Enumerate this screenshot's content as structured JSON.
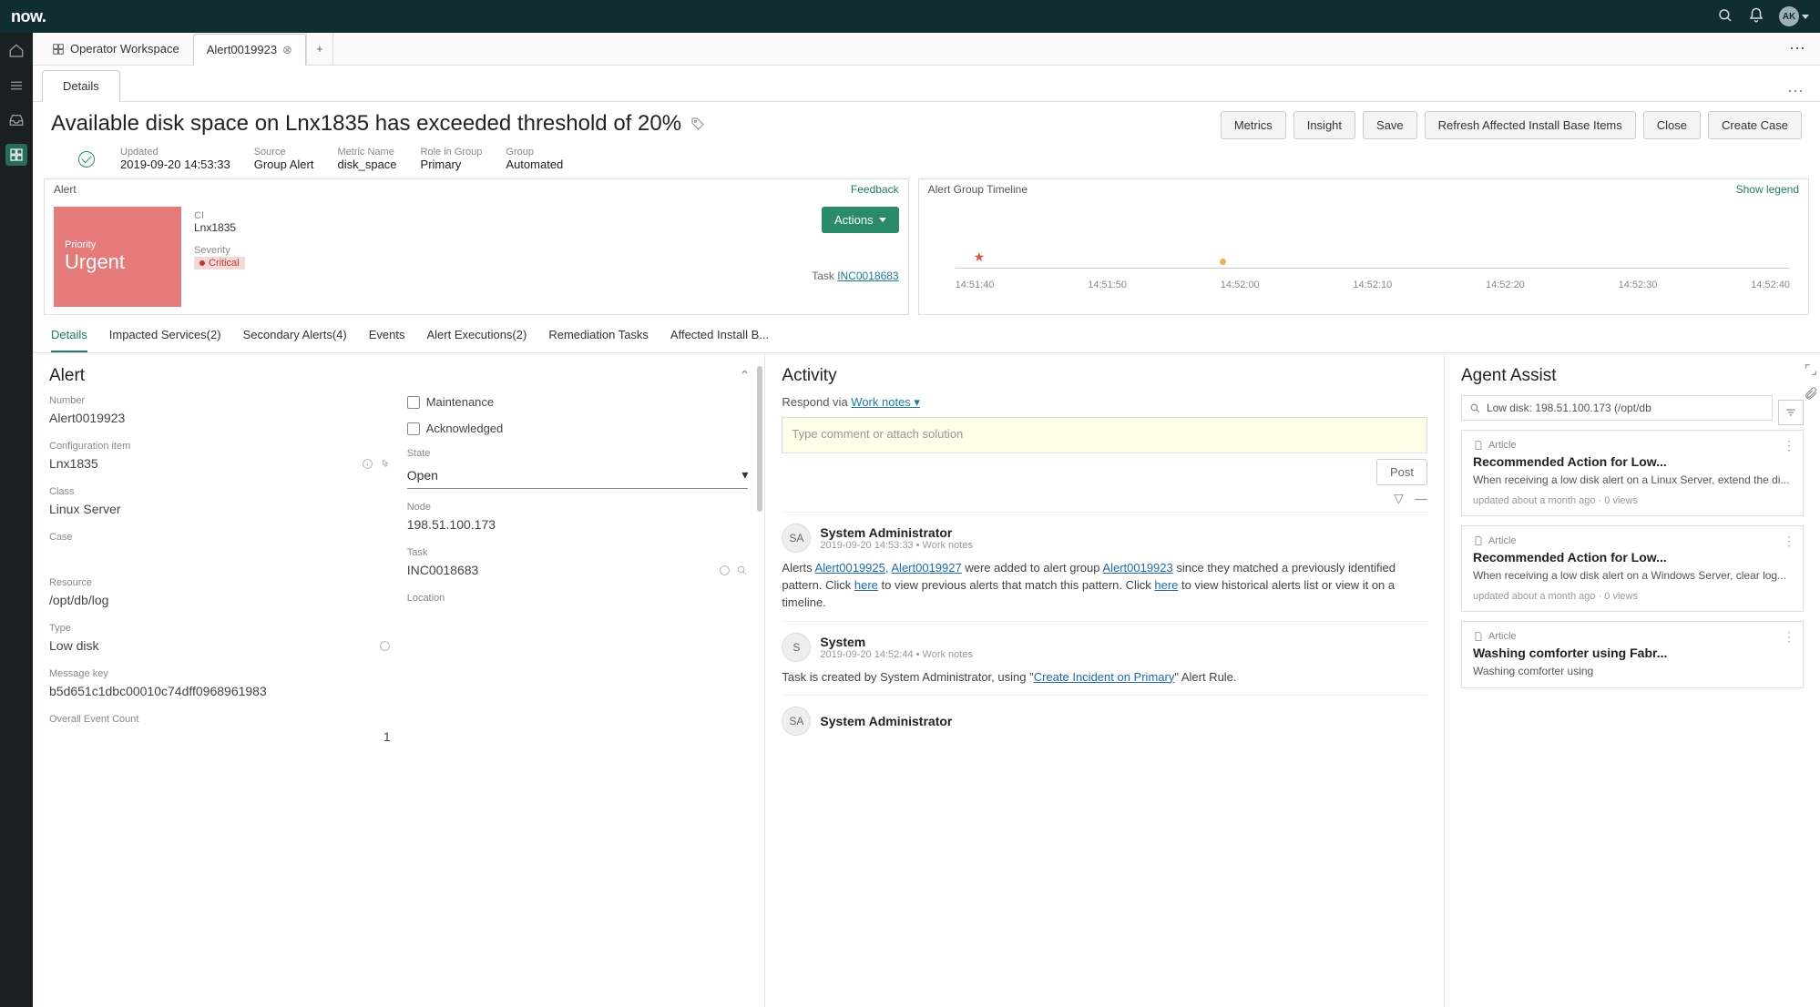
{
  "banner": {
    "logo": "now.",
    "avatar": "AK"
  },
  "wsTabs": {
    "operator": "Operator Workspace",
    "active": "Alert0019923"
  },
  "subTab": "Details",
  "header": {
    "title": "Available disk space on Lnx1835 has exceeded threshold of 20%",
    "updated_label": "Updated",
    "updated": "2019-09-20 14:53:33",
    "source_label": "Source",
    "source": "Group Alert",
    "metric_label": "Metric Name",
    "metric": "disk_space",
    "role_label": "Role in Group",
    "role": "Primary",
    "group_label": "Group",
    "group": "Automated"
  },
  "buttons": {
    "metrics": "Metrics",
    "insight": "Insight",
    "save": "Save",
    "refresh": "Refresh Affected Install Base Items",
    "close": "Close",
    "createCase": "Create Case",
    "actions": "Actions"
  },
  "alertCard": {
    "header": "Alert",
    "feedback": "Feedback",
    "priority_label": "Priority",
    "priority": "Urgent",
    "ci_label": "CI",
    "ci": "Lnx1835",
    "severity_label": "Severity",
    "severity": "Critical",
    "task_label": "Task",
    "task": "INC0018683"
  },
  "timelineCard": {
    "header": "Alert Group Timeline",
    "legend": "Show legend",
    "ticks": [
      "14:51:40",
      "14:51:50",
      "14:52:00",
      "14:52:10",
      "14:52:20",
      "14:52:30",
      "14:52:40"
    ]
  },
  "innerTabs": {
    "details": "Details",
    "impacted": "Impacted Services(2)",
    "secondary": "Secondary Alerts(4)",
    "events": "Events",
    "exec": "Alert Executions(2)",
    "remed": "Remediation Tasks",
    "affected": "Affected Install B..."
  },
  "form": {
    "heading": "Alert",
    "number_label": "Number",
    "number": "Alert0019923",
    "ci_label": "Configuration item",
    "ci": "Lnx1835",
    "class_label": "Class",
    "class": "Linux Server",
    "case_label": "Case",
    "resource_label": "Resource",
    "resource": "/opt/db/log",
    "type_label": "Type",
    "type": "Low disk",
    "msgkey_label": "Message key",
    "msgkey": "b5d651c1dbc00010c74dff0968961983",
    "overall_label": "Overall Event Count",
    "overall": "1",
    "maintenance": "Maintenance",
    "acknowledged": "Acknowledged",
    "state_label": "State",
    "state": "Open",
    "node_label": "Node",
    "node": "198.51.100.173",
    "task_label": "Task",
    "task": "INC0018683",
    "location_label": "Location"
  },
  "activity": {
    "heading": "Activity",
    "respond_prefix": "Respond via ",
    "respond_link": "Work notes",
    "placeholder": "Type comment or attach solution",
    "post": "Post",
    "items": [
      {
        "avatar": "SA",
        "name": "System Administrator",
        "meta": "2019-09-20 14:53:33 • Work notes",
        "body_pre": "Alerts ",
        "link1": "Alert0019925",
        "comma": ", ",
        "link2": "Alert0019927",
        "body_mid": " were added to alert group ",
        "link3": "Alert0019923",
        "body_after1": " since they matched a previously identified pattern. Click ",
        "here1": "here",
        "body_after2": " to view previous alerts that match this pattern. Click ",
        "here2": "here",
        "body_after3": " to view historical alerts list or view it on a timeline."
      },
      {
        "avatar": "S",
        "name": "System",
        "meta": "2019-09-20 14:52:44 • Work notes",
        "body_pre": "Task is created by System Administrator, using \"",
        "link1": "Create Incident on Primary",
        "body_after1": "\" Alert Rule."
      },
      {
        "avatar": "SA",
        "name": "System Administrator",
        "meta": ""
      }
    ]
  },
  "assist": {
    "heading": "Agent Assist",
    "search": "Low disk: 198.51.100.173 (/opt/db",
    "cards": [
      {
        "type": "Article",
        "title": "Recommended Action for Low...",
        "summary": "When receiving a low disk alert on a Linux Server, extend the di...",
        "meta": "updated about a month ago · 0 views"
      },
      {
        "type": "Article",
        "title": "Recommended Action for Low...",
        "summary": "When receiving a low disk alert on a Windows Server, clear log...",
        "meta": "updated about a month ago · 0 views"
      },
      {
        "type": "Article",
        "title": "Washing comforter using Fabr...",
        "summary": "Washing comforter using",
        "meta": ""
      }
    ]
  }
}
